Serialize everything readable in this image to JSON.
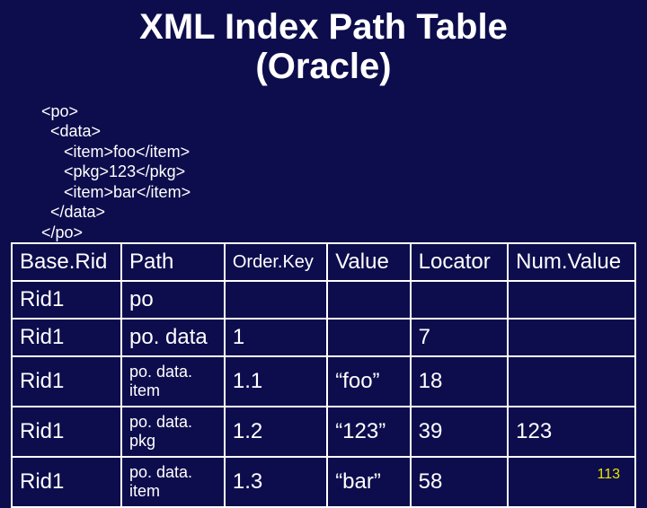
{
  "title_line1": "XML Index Path Table",
  "title_line2": "(Oracle)",
  "xml_lines": [
    "<po>",
    "  <data>",
    "     <item>foo</item>",
    "     <pkg>123</pkg>",
    "     <item>bar</item>",
    "  </data>",
    "</po>"
  ],
  "headers": {
    "baserid": "Base.Rid",
    "path": "Path",
    "orderkey": "Order.Key",
    "value": "Value",
    "locator": "Locator",
    "numvalue": "Num.Value"
  },
  "rows": [
    {
      "baserid": "Rid1",
      "path": "po",
      "path_small": false,
      "orderkey": "",
      "value": "",
      "locator": "",
      "numvalue": ""
    },
    {
      "baserid": "Rid1",
      "path": "po. data",
      "path_small": false,
      "orderkey": "1",
      "value": "",
      "locator": "7",
      "numvalue": ""
    },
    {
      "baserid": "Rid1",
      "path": "po. data. item",
      "path_small": true,
      "orderkey": "1.1",
      "value": "“foo”",
      "locator": "18",
      "numvalue": ""
    },
    {
      "baserid": "Rid1",
      "path": "po. data. pkg",
      "path_small": true,
      "orderkey": "1.2",
      "value": "“123”",
      "locator": "39",
      "numvalue": "123"
    },
    {
      "baserid": "Rid1",
      "path": "po. data. item",
      "path_small": true,
      "orderkey": "1.3",
      "value": "“bar”",
      "locator": "58",
      "numvalue": ""
    }
  ],
  "page_number": "113"
}
